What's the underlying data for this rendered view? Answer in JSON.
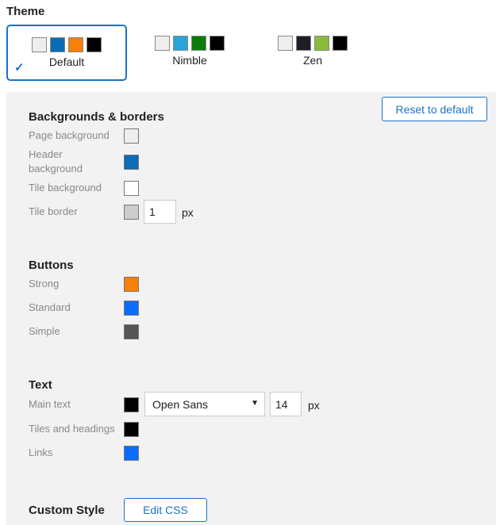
{
  "theme": {
    "title": "Theme",
    "selected_mark": "✓",
    "options": [
      {
        "name": "Default",
        "selected": true,
        "swatches": [
          "#eeeeee",
          "#0a6db5",
          "#f7800a",
          "#000000"
        ]
      },
      {
        "name": "Nimble",
        "selected": false,
        "swatches": [
          "#eeeeee",
          "#2aa3d9",
          "#0a7d0a",
          "#000000"
        ]
      },
      {
        "name": "Zen",
        "selected": false,
        "swatches": [
          "#eeeeee",
          "#1e1e26",
          "#8bbb3c",
          "#000000"
        ]
      }
    ]
  },
  "reset_label": "Reset to default",
  "backgrounds": {
    "title": "Backgrounds & borders",
    "page_bg": {
      "label": "Page background",
      "color": "#eeeeee"
    },
    "header_bg": {
      "label_line1": "Header",
      "label_line2": "background",
      "color": "#0a6db5"
    },
    "tile_bg": {
      "label": "Tile background",
      "color": "#ffffff"
    },
    "tile_border": {
      "label": "Tile border",
      "color": "#cccccc",
      "width": "1",
      "unit": "px"
    }
  },
  "buttons": {
    "title": "Buttons",
    "strong": {
      "label": "Strong",
      "color": "#f7800a"
    },
    "standard": {
      "label": "Standard",
      "color": "#0a6dff"
    },
    "simple": {
      "label": "Simple",
      "color": "#555555"
    }
  },
  "text": {
    "title": "Text",
    "main": {
      "label": "Main text",
      "color": "#000000",
      "font": "Open Sans",
      "size": "14",
      "unit": "px"
    },
    "tiles_headings": {
      "label": "Tiles and headings",
      "color": "#000000"
    },
    "links": {
      "label": "Links",
      "color": "#0a6dff"
    }
  },
  "custom_style": {
    "title": "Custom Style",
    "edit_label": "Edit CSS"
  }
}
